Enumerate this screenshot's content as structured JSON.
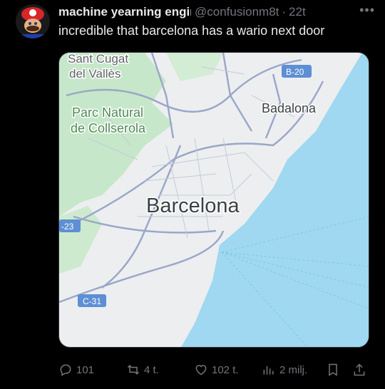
{
  "tweet": {
    "display_name": "machine yearning engin",
    "handle": "@confusionm8t",
    "time": "22t",
    "text": "incredible that barcelona has a wario next door"
  },
  "map_labels": {
    "sant_cugat_1": "Sant Cugat",
    "sant_cugat_2": "del Vallès",
    "parc_1": "Parc Natural",
    "parc_2": "de Collserola",
    "badalona": "Badalona",
    "barcelona": "Barcelona",
    "b20": "B-20",
    "c31": "C-31",
    "r23": "-23"
  },
  "actions": {
    "replies": "101",
    "reposts": "4 t.",
    "likes": "102 t.",
    "views": "2 milj."
  },
  "colors": {
    "background": "#000000",
    "secondary_text": "#71767b",
    "sea": "#9fd8f0",
    "land": "#eceef0",
    "park": "#c6e7c9",
    "road_label": "#5e8fd4"
  },
  "icons": {
    "more": "more-dots-icon",
    "reply": "reply-icon",
    "repost": "repost-icon",
    "like": "heart-icon",
    "views": "views-icon",
    "bookmark": "bookmark-icon",
    "share": "share-icon"
  }
}
